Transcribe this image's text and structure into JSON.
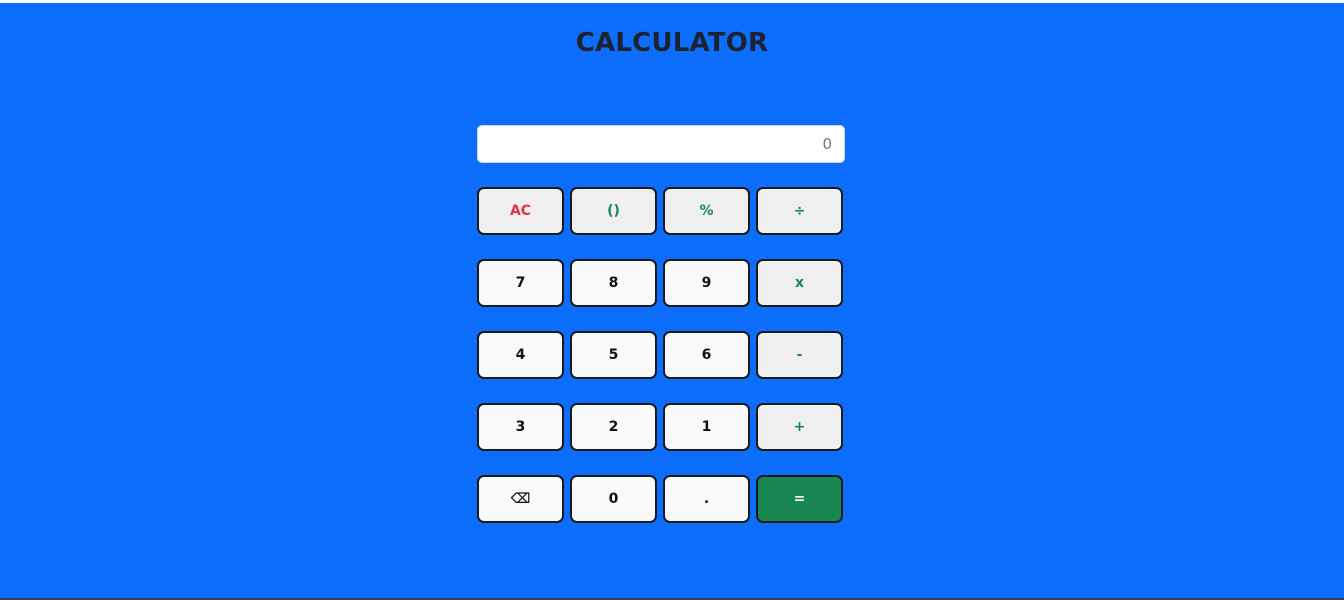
{
  "page": {
    "title": "CALCULATOR"
  },
  "display": {
    "value": "",
    "placeholder": "0"
  },
  "keys": {
    "row1": [
      "AC",
      "()",
      "%",
      "÷"
    ],
    "row2": [
      "7",
      "8",
      "9",
      "x"
    ],
    "row3": [
      "4",
      "5",
      "6",
      "-"
    ],
    "row4": [
      "3",
      "2",
      "1",
      "+"
    ],
    "row5": [
      "⌫",
      "0",
      ".",
      "="
    ]
  },
  "colors": {
    "background": "#0d6efd",
    "operator_text": "#198754",
    "clear_text": "#dc3545",
    "equals_background": "#198754"
  }
}
